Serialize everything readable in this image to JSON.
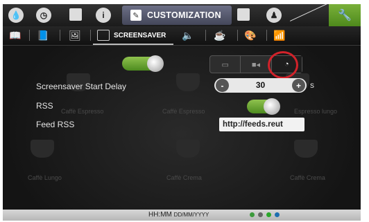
{
  "top_tabs": {
    "active_label": "CUSTOMIZATION",
    "icons": [
      "water-drop-icon",
      "clock-icon",
      "flag-icon",
      "info-icon",
      "pencil-icon",
      "calculator-icon",
      "user-icon",
      "wrench-icon"
    ]
  },
  "sub_tabs": {
    "active_label": "SCREENSAVER",
    "icons": [
      "book-icon",
      "open-book-icon",
      "image-icon",
      "screensaver-icon",
      "speaker-icon",
      "beans-icon",
      "palette-icon",
      "wifi-icon"
    ]
  },
  "screensaver": {
    "enabled": true,
    "mode_options": [
      "image-mode-icon",
      "video-mode-icon",
      "clock-mode-icon"
    ],
    "selected_mode": "clock-mode-icon"
  },
  "settings": {
    "start_delay_label": "Screensaver Start Delay",
    "start_delay_value": "30",
    "start_delay_unit": "s",
    "rss_label": "RSS",
    "rss_enabled": true,
    "feed_label": "Feed RSS",
    "feed_value": "http://feeds.reut"
  },
  "background_items": [
    "Caffè Espresso",
    "Caffè Espresso",
    "Espresso lungo",
    "Caffè Lungo",
    "Caffè Crema",
    "Caffè Crema"
  ],
  "status_bar": {
    "time": "HH:MM",
    "date": "DD/MM/YYYY"
  },
  "colors": {
    "accent_green": "#6aa82e",
    "tab_active": "#55586e",
    "highlight_circle": "#d2222a"
  }
}
